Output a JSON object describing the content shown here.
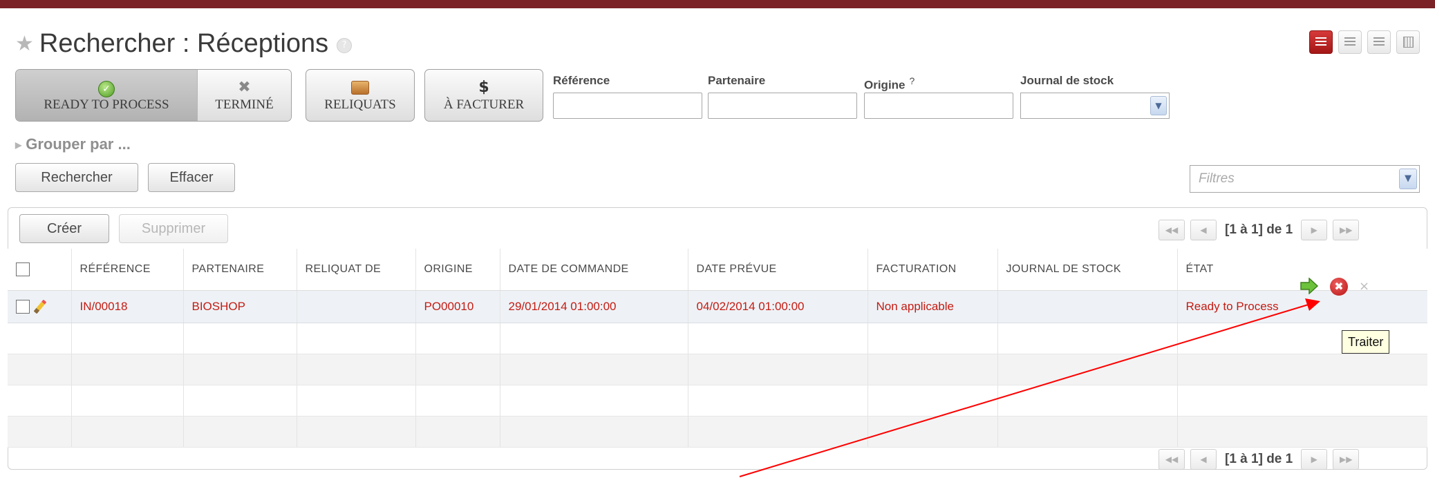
{
  "header": {
    "title": "Rechercher : Réceptions",
    "help": "?"
  },
  "view_switch": [
    "list-view-icon",
    "grid-view-icon",
    "form-view-icon",
    "calendar-view-icon"
  ],
  "filters": {
    "ready_to_process": "READY TO PROCESS",
    "termine": "TERMINÉ",
    "reliquats": "RELIQUATS",
    "a_facturer": "À FACTURER"
  },
  "search_fields": {
    "reference_label": "Référence",
    "partenaire_label": "Partenaire",
    "origine_label": "Origine",
    "origine_help": "?",
    "journal_label": "Journal de stock"
  },
  "group_by": "Grouper par ...",
  "buttons": {
    "rechercher": "Rechercher",
    "effacer": "Effacer",
    "creer": "Créer",
    "supprimer": "Supprimer"
  },
  "filters_select_placeholder": "Filtres",
  "pager": {
    "info": "[1 à 1] de 1"
  },
  "table": {
    "columns": [
      "RÉFÉRENCE",
      "PARTENAIRE",
      "RELIQUAT DE",
      "ORIGINE",
      "DATE DE COMMANDE",
      "DATE PRÉVUE",
      "FACTURATION",
      "JOURNAL DE STOCK",
      "ÉTAT"
    ],
    "rows": [
      {
        "reference": "IN/00018",
        "partenaire": "BIOSHOP",
        "reliquat_de": "",
        "origine": "PO00010",
        "date_commande": "29/01/2014 01:00:00",
        "date_prevue": "04/02/2014 01:00:00",
        "facturation": "Non applicable",
        "journal": "",
        "etat": "Ready to Process"
      }
    ]
  },
  "tooltip": "Traiter",
  "colors": {
    "top_bar": "#7a2226",
    "row_text": "#c41b12",
    "annotation_arrow": "#ff0000"
  }
}
